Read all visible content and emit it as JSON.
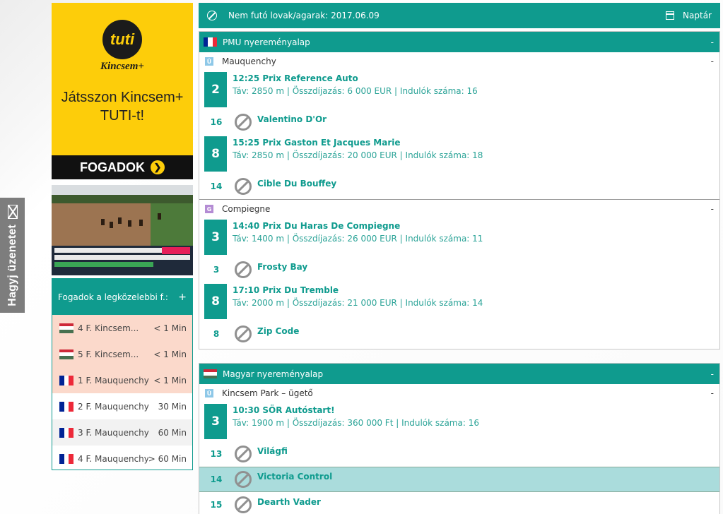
{
  "feedback": {
    "label": "Hagyj üzenetet"
  },
  "ad": {
    "logo_text": "tuti",
    "brand": "Kincsem+",
    "headline_line1": "Játsszon Kincsem+",
    "headline_line2": "TUTI-t!",
    "cta": "FOGADOK"
  },
  "bets": {
    "header": "Fogadok a legközelebbi f.:",
    "toggle": "+",
    "rows": [
      {
        "flag": "hu",
        "label": "4 F. Kincsem...",
        "time": "< 1 Min"
      },
      {
        "flag": "hu",
        "label": "5 F. Kincsem...",
        "time": "< 1 Min"
      },
      {
        "flag": "fr",
        "label": "1 F. Mauquenchy",
        "time": "< 1 Min"
      },
      {
        "flag": "fr",
        "label": "2 F. Mauquenchy",
        "time": "30 Min"
      },
      {
        "flag": "fr",
        "label": "3 F. Mauquenchy",
        "time": "60 Min"
      },
      {
        "flag": "fr",
        "label": "4 F. Mauquenchy",
        "time": "> 60 Min"
      }
    ]
  },
  "topbar": {
    "title": "Nem futó lovak/agarak: 2017.06.09",
    "calendar": "Naptár"
  },
  "sections": [
    {
      "flag": "fr",
      "name": "PMU nyereményalap",
      "toggle": "-",
      "venues": [
        {
          "badge": "Ü",
          "name": "Mauquenchy",
          "toggle": "-",
          "races": [
            {
              "num": "2",
              "title": "12:25 Prix Reference Auto",
              "detail": "Táv: 2850 m | Összdíjazás: 6 000 EUR | Indulók száma: 16",
              "runners": [
                {
                  "num": "16",
                  "name": "Valentino D'Or"
                }
              ]
            },
            {
              "num": "8",
              "title": "15:25 Prix Gaston Et Jacques Marie",
              "detail": "Táv: 2850 m | Összdíjazás: 20 000 EUR | Indulók száma: 18",
              "runners": [
                {
                  "num": "14",
                  "name": "Cible Du Bouffey"
                }
              ]
            }
          ]
        },
        {
          "badge": "G",
          "name": "Compiegne",
          "toggle": "-",
          "races": [
            {
              "num": "3",
              "title": "14:40 Prix Du Haras De Compiegne",
              "detail": "Táv: 1400 m | Összdíjazás: 26 000 EUR | Indulók száma: 11",
              "runners": [
                {
                  "num": "3",
                  "name": "Frosty Bay"
                }
              ]
            },
            {
              "num": "8",
              "title": "17:10 Prix Du Tremble",
              "detail": "Táv: 2000 m | Összdíjazás: 21 000 EUR | Indulók száma: 14",
              "runners": [
                {
                  "num": "8",
                  "name": "Zip Code"
                }
              ]
            }
          ]
        }
      ]
    },
    {
      "flag": "hu",
      "name": "Magyar nyereményalap",
      "toggle": "-",
      "venues": [
        {
          "badge": "Ü",
          "name": "Kincsem Park – ügető",
          "toggle": "-",
          "races": [
            {
              "num": "3",
              "title": "10:30 SÖR Autóstart!",
              "detail": "Táv: 1900 m | Összdíjazás: 360 000 Ft | Indulók száma: 16",
              "runners": [
                {
                  "num": "13",
                  "name": "Világfi"
                },
                {
                  "num": "14",
                  "name": "Victoria Control"
                },
                {
                  "num": "15",
                  "name": "Dearth Vader"
                }
              ]
            }
          ]
        }
      ]
    }
  ]
}
